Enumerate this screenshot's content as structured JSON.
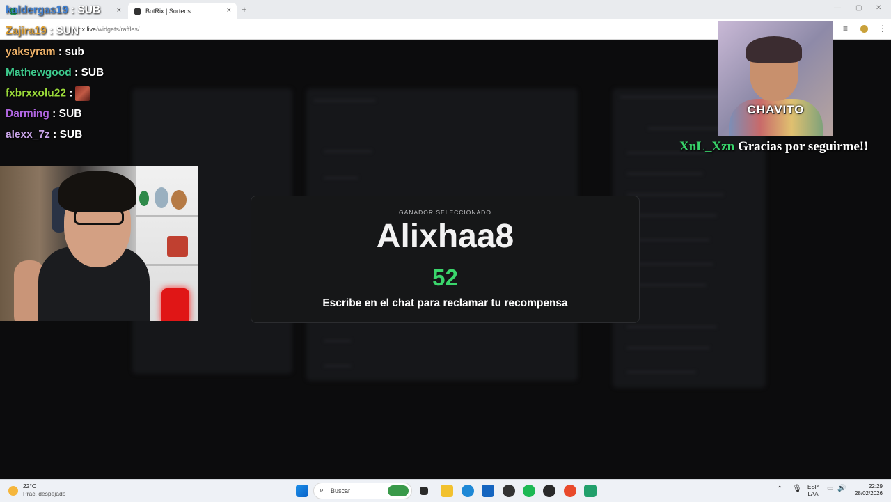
{
  "browser": {
    "tabs": [
      {
        "label": "",
        "active": false
      },
      {
        "label": "BotRix | Sorteos",
        "active": true
      }
    ],
    "url_host": "trix.live",
    "url_path": "/widgets/raffles/",
    "new_tab_icon": "+",
    "close_icon": "×",
    "window_controls": [
      "—",
      "▢",
      "✕"
    ]
  },
  "chat": [
    {
      "user": "kaldergas19",
      "color": "#3f7fd0",
      "message": "SUB"
    },
    {
      "user": "Zajira19",
      "color": "#e0a030",
      "message": "SUN"
    },
    {
      "user": "yaksyram",
      "color": "#f0b36a",
      "message": "sub"
    },
    {
      "user": "Mathewgood",
      "color": "#3dc88c",
      "message": "SUB"
    },
    {
      "user": "fxbrxxolu22",
      "color": "#9bdb3a",
      "message": "",
      "emote": true
    },
    {
      "user": "Darming",
      "color": "#b066e0",
      "message": "SUB"
    },
    {
      "user": "alexx_7z",
      "color": "#c9a4e8",
      "message": "SUB"
    }
  ],
  "cam_overlay": {
    "label": "CHAVITO"
  },
  "follow_alert": {
    "user": "XnL_Xzn",
    "text": "Gracias por seguirme!!"
  },
  "raffle": {
    "kicker": "GANADOR SELECCIONADO",
    "winner": "Alixhaa8",
    "number": "52",
    "claim": "Escribe en el chat para reclamar tu recompensa",
    "accent_color": "#3ad56b"
  },
  "taskbar": {
    "weather_temp": "22°C",
    "weather_cond": "Prac. despejado",
    "search_placeholder": "Buscar",
    "lang_line1": "ESP",
    "lang_line2": "LAA",
    "time": "22:29",
    "date": "28/02/2026"
  }
}
